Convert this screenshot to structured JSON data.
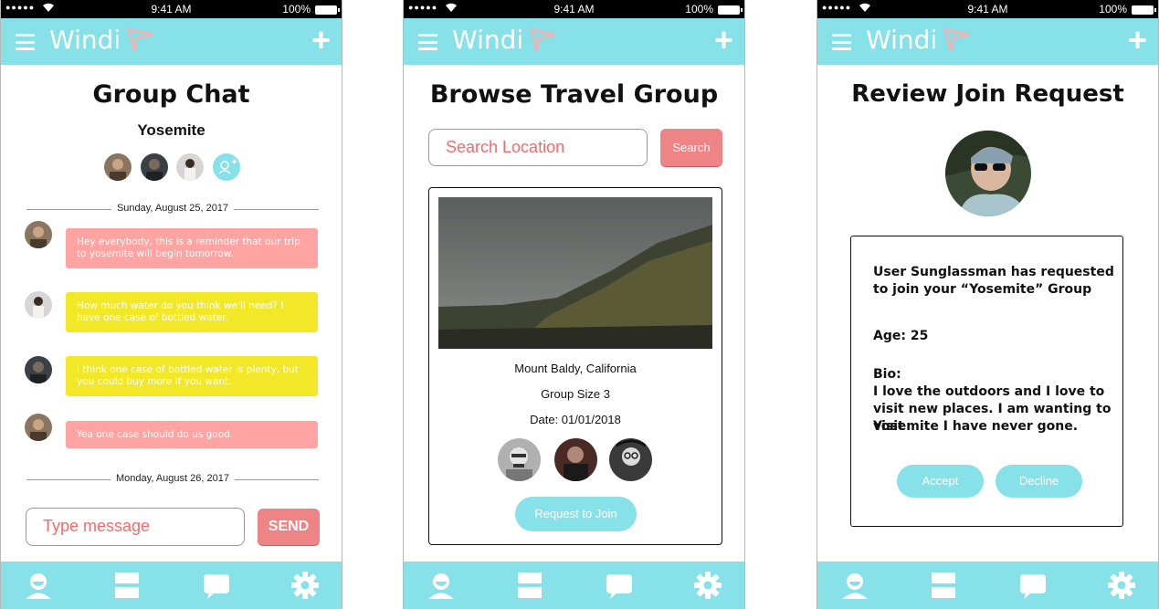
{
  "status_bar": {
    "signal": "●●●●●",
    "time": "9:41 AM",
    "battery": "100%"
  },
  "header": {
    "brand": "Windi"
  },
  "colors": {
    "accent": "#87e1e8",
    "pink": "#ffa4a2",
    "yellow": "#f3e827",
    "coral": "#ee8486",
    "placeholder": "#f26b6b"
  },
  "tabbar": {
    "icons": [
      "profile-icon",
      "groups-icon",
      "chat-icon",
      "settings-icon"
    ]
  },
  "group_chat": {
    "title": "Group Chat",
    "group_name": "Yosemite",
    "date1": "Sunday, August 25, 2017",
    "date2": "Monday, August 26, 2017",
    "messages": [
      {
        "text": "Hey everybody, this is a reminder that our trip to yosemite will begin tomorrow.",
        "color": "pink"
      },
      {
        "text": "How much water do you think we'll need? I have one case of bottled water.",
        "color": "yellow"
      },
      {
        "text": "I think one case of bottled water is plenty, but you could buy more if you want.",
        "color": "yellow"
      },
      {
        "text": "Yea one case should do us good.",
        "color": "pink"
      }
    ],
    "input_placeholder": "Type message",
    "send_label": "SEND"
  },
  "browse": {
    "title": "Browse Travel Group",
    "search_placeholder": "Search Location",
    "search_label": "Search",
    "location": "Mount Baldy, California",
    "group_size": "Group Size 3",
    "date": "Date: 01/01/2018",
    "join_label": "Request to Join"
  },
  "review": {
    "title": "Review Join Request",
    "request_line1": "User Sunglassman has requested",
    "request_line2": "to join your “Yosemite” Group",
    "age": "Age: 25",
    "bio_label": "Bio:",
    "bio_line1": "I love the outdoors and I love to",
    "bio_line2": "visit new places. I am wanting to visit",
    "bio_line3": "Yosemite   I have never gone.",
    "accept_label": "Accept",
    "decline_label": "Decline"
  }
}
